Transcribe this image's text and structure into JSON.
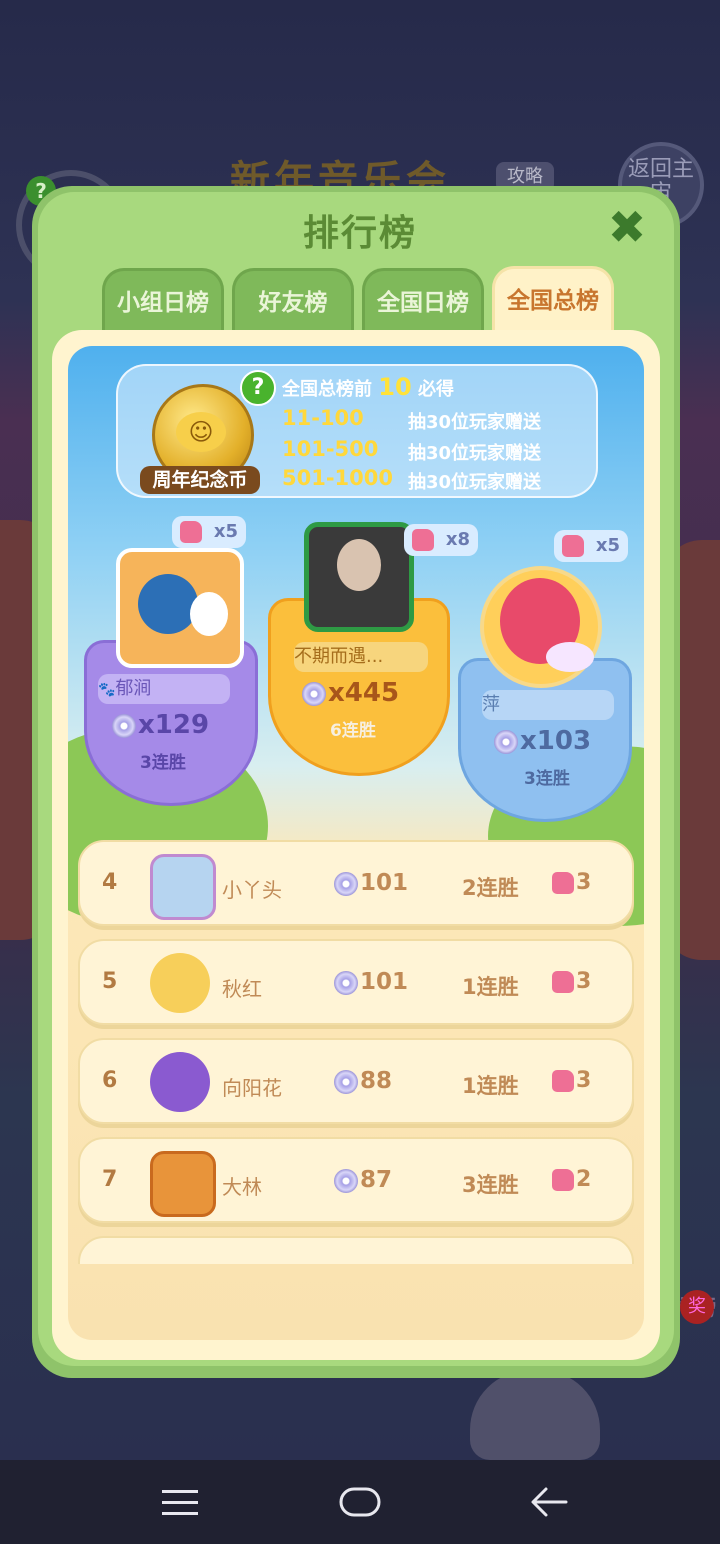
{
  "background": {
    "event_title": "新年音乐会",
    "guide_badge": "攻略",
    "back_button": "返回主宙",
    "help_mark": "?",
    "rank_label": "排行榜",
    "prize_badge": "奖"
  },
  "modal": {
    "title": "排行榜",
    "close_glyph": "✖"
  },
  "tabs": [
    {
      "label": "小组日榜",
      "active": false
    },
    {
      "label": "好友榜",
      "active": false
    },
    {
      "label": "全国日榜",
      "active": false
    },
    {
      "label": "全国总榜",
      "active": true
    }
  ],
  "reward_info": {
    "help_glyph": "?",
    "coin_label": "周年纪念币",
    "coin_face": "☺",
    "headline_prefix": "全国总榜前",
    "headline_number": "10",
    "headline_suffix": "必得",
    "tiers": [
      {
        "range": "11-100",
        "text": "抽30位玩家赠送"
      },
      {
        "range": "101-500",
        "text": "抽30位玩家赠送"
      },
      {
        "range": "501-1000",
        "text": "抽30位玩家赠送"
      }
    ]
  },
  "podium": {
    "first": {
      "name": "不期而遇...",
      "score": "x445",
      "streak": "6连胜",
      "pieces": "x8"
    },
    "second": {
      "name": "郁涧",
      "name_icon": "🐾",
      "score": "x129",
      "streak": "3连胜",
      "pieces": "x5"
    },
    "third": {
      "name": "萍",
      "score": "x103",
      "streak": "3连胜",
      "pieces": "x5"
    }
  },
  "rows": [
    {
      "rank": "4",
      "name": "小丫头",
      "score": "101",
      "streak": "2连胜",
      "pieces": "3"
    },
    {
      "rank": "5",
      "name": "秋红",
      "score": "101",
      "streak": "1连胜",
      "pieces": "3"
    },
    {
      "rank": "6",
      "name": "向阳花",
      "score": "88",
      "streak": "1连胜",
      "pieces": "3"
    },
    {
      "rank": "7",
      "name": "大林",
      "score": "87",
      "streak": "3连胜",
      "pieces": "2"
    }
  ],
  "colors": {
    "modal_green": "#a8d97e",
    "tab_active_text": "#c8762e",
    "gold_shield": "#fbbf3c",
    "purple_shield": "#a58ae8",
    "blue_shield": "#8fc0f0"
  },
  "navbar": {
    "menu_icon": "menu-icon",
    "home_icon": "home-icon",
    "back_icon": "back-arrow-icon"
  }
}
